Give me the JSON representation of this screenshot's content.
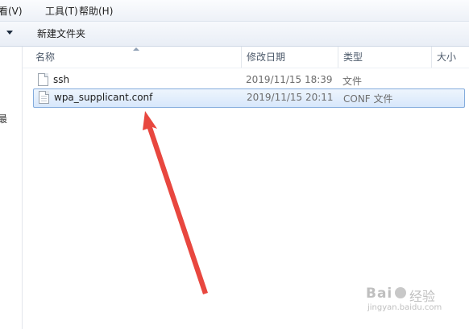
{
  "menubar": {
    "items": [
      {
        "label": "看(V)"
      },
      {
        "label": "工具(T)"
      },
      {
        "label": "帮助(H)"
      }
    ]
  },
  "toolbar": {
    "organize_arrow_icon": "chevron-down-icon",
    "new_folder_label": "新建文件夹"
  },
  "navpane": {
    "partial_glyph": "最"
  },
  "columns": {
    "name": "名称",
    "date": "修改日期",
    "type": "类型",
    "size": "大小"
  },
  "files": [
    {
      "name": "ssh",
      "date": "2019/11/15 18:39",
      "type": "文件",
      "icon": "file-icon",
      "selected": false
    },
    {
      "name": "wpa_supplicant.conf",
      "date": "2019/11/15 20:11",
      "type": "CONF 文件",
      "icon": "conf-file-icon",
      "selected": true
    }
  ],
  "annotation": {
    "arrow_color": "#e8473f"
  },
  "watermark": {
    "logo": "Bai",
    "text": "经验",
    "url": "jingyan.baidu.com"
  },
  "colors": {
    "selection_border": "#84acdd",
    "selection_fill": "#d7e7fb"
  }
}
